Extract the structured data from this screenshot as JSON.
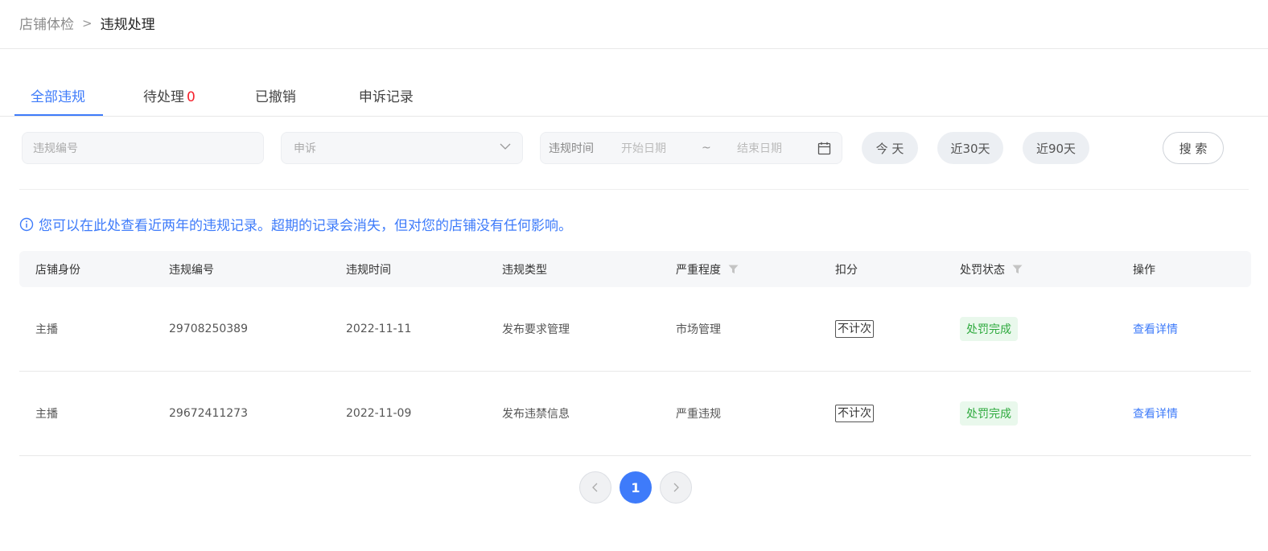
{
  "breadcrumb": {
    "parent": "店铺体检",
    "separator": ">",
    "current": "违规处理"
  },
  "tabs": [
    {
      "label": "全部违规",
      "active": true
    },
    {
      "label": "待处理",
      "count": "0"
    },
    {
      "label": "已撤销"
    },
    {
      "label": "申诉记录"
    }
  ],
  "filters": {
    "code_placeholder": "违规编号",
    "appeal_placeholder": "申诉",
    "date_label": "违规时间",
    "start_placeholder": "开始日期",
    "tilde": "~",
    "end_placeholder": "结束日期",
    "quick": [
      "今 天",
      "近30天",
      "近90天"
    ],
    "search_label": "搜 索"
  },
  "notice": "您可以在此处查看近两年的违规记录。超期的记录会消失，但对您的店铺没有任何影响。",
  "table": {
    "columns": [
      "店铺身份",
      "违规编号",
      "违规时间",
      "违规类型",
      "严重程度",
      "扣分",
      "处罚状态",
      "操作"
    ],
    "rows": [
      [
        "主播",
        "29708250389",
        "2022-11-11",
        "发布要求管理",
        "市场管理",
        "不计次",
        "处罚完成",
        "查看详情"
      ],
      [
        "主播",
        "29672411273",
        "2022-11-09",
        "发布违禁信息",
        "严重违规",
        "不计次",
        "处罚完成",
        "查看详情"
      ]
    ]
  },
  "pagination": {
    "current": "1"
  },
  "colors": {
    "accent": "#3e7bfa",
    "danger": "#f5222d",
    "success": "#2eaa3e",
    "success_bg": "#e9f8ec"
  },
  "icons": {
    "info": "info-circle-icon",
    "calendar": "calendar-icon",
    "chevron": "chevron-down-icon",
    "filter": "funnel-filter-icon"
  }
}
